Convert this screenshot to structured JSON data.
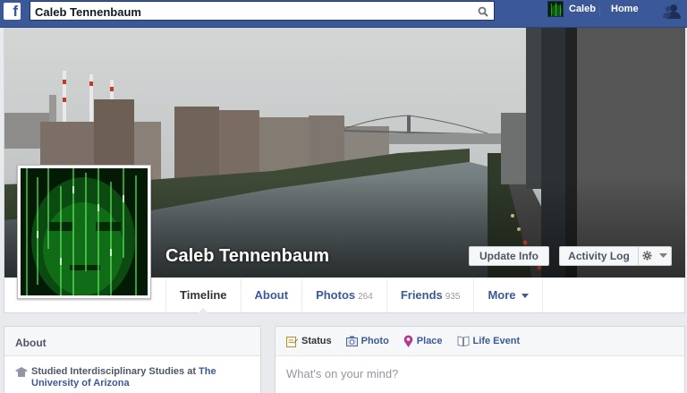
{
  "topbar": {
    "logo": "f",
    "search_value": "Caleb Tennenbaum",
    "user_name": "Caleb",
    "home_label": "Home",
    "icons": [
      "search-icon",
      "friend-requests-icon"
    ]
  },
  "profile": {
    "name": "Caleb Tennenbaum",
    "buttons": {
      "update_info": "Update Info",
      "activity_log": "Activity Log"
    }
  },
  "tabs": [
    {
      "label": "Timeline",
      "count": ""
    },
    {
      "label": "About",
      "count": ""
    },
    {
      "label": "Photos",
      "count": "264"
    },
    {
      "label": "Friends",
      "count": "935"
    },
    {
      "label": "More",
      "count": ""
    }
  ],
  "about": {
    "title": "About",
    "item_prefix": "Studied Interdisciplinary Studies at ",
    "item_link": "The University of Arizona"
  },
  "composer": {
    "tabs": [
      "Status",
      "Photo",
      "Place",
      "Life Event"
    ],
    "placeholder": "What's on your mind?"
  },
  "colors": {
    "brand": "#3b5998",
    "background": "#e9eaed"
  }
}
